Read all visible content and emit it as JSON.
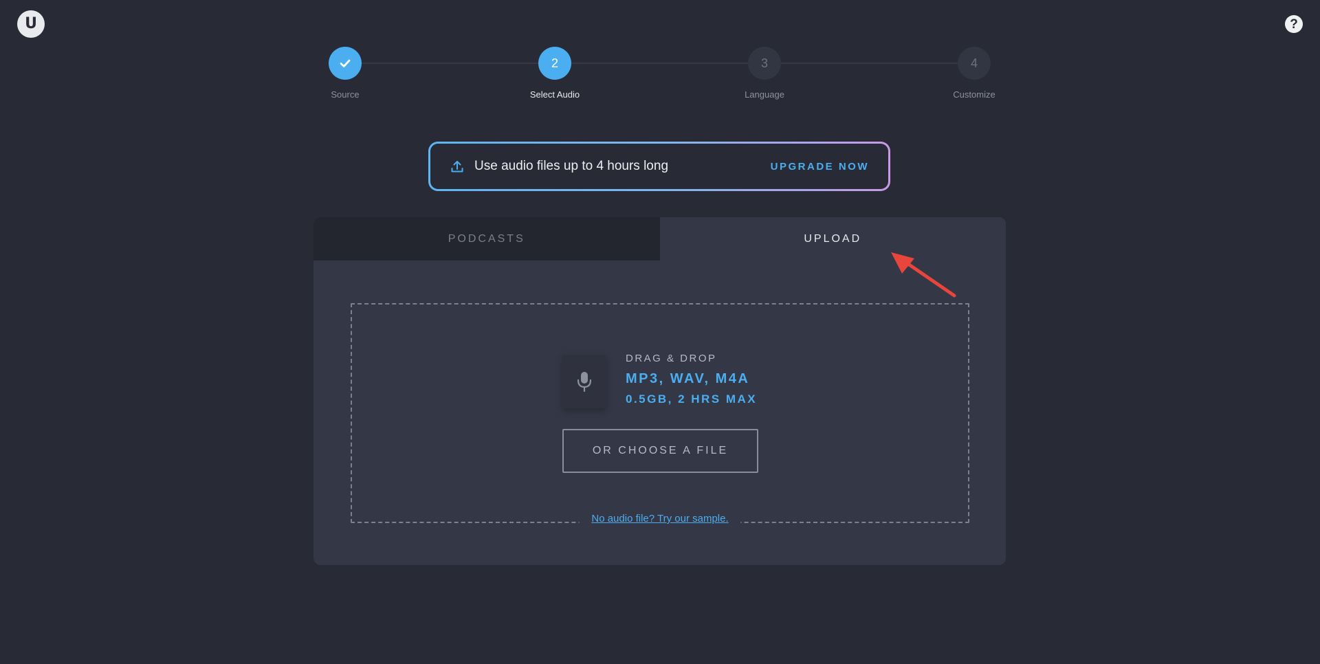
{
  "header": {
    "logo_text": "U",
    "help_icon": "question-circle-icon",
    "help_text": "?"
  },
  "stepper": {
    "steps": [
      {
        "label": "Source",
        "number": "",
        "state": "done"
      },
      {
        "label": "Select Audio",
        "number": "2",
        "state": "active"
      },
      {
        "label": "Language",
        "number": "3",
        "state": "todo"
      },
      {
        "label": "Customize",
        "number": "4",
        "state": "todo"
      }
    ]
  },
  "banner": {
    "icon": "upload-icon",
    "text": "Use audio files up to 4 hours long",
    "upgrade_label": "UPGRADE NOW",
    "gradient": [
      "#5fb4f2",
      "#c89ae6"
    ]
  },
  "tabs": [
    {
      "label": "PODCASTS",
      "active": false
    },
    {
      "label": "UPLOAD",
      "active": true
    }
  ],
  "dropzone": {
    "icon": "microphone-icon",
    "drag_label": "DRAG & DROP",
    "formats": "MP3, WAV, M4A",
    "limits": "0.5GB, 2 HRS MAX",
    "choose_label": "OR CHOOSE A FILE",
    "sample_link": "No audio file? Try our sample."
  },
  "colors": {
    "accent": "#4aaef0",
    "background": "#282b36",
    "card": "#343745",
    "annotation_arrow": "#e8453c"
  }
}
